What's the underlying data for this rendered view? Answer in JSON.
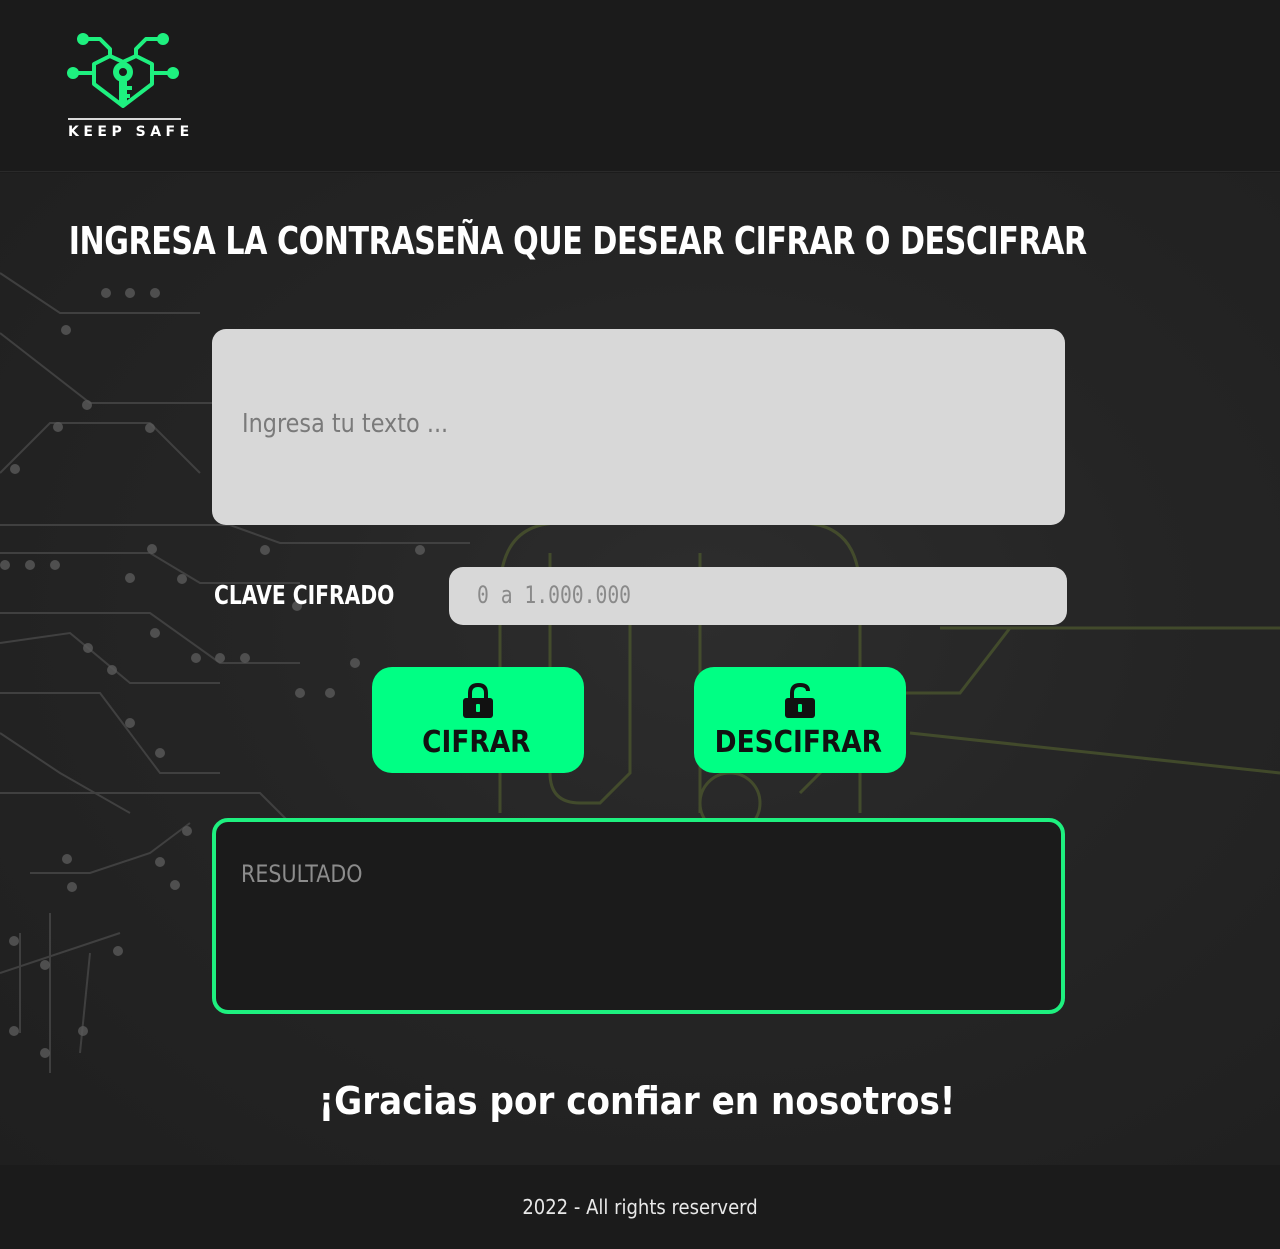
{
  "header": {
    "logo_text": "KEEP SAFE",
    "logo_icon": "circuit-key-shield-icon"
  },
  "main": {
    "title": "INGRESA LA CONTRASEÑA QUE DESEAR CIFRAR O DESCIFRAR",
    "text_input": {
      "placeholder": "Ingresa tu texto ...",
      "value": ""
    },
    "key_label": "CLAVE CIFRADO",
    "key_input": {
      "placeholder": "0 a 1.000.000",
      "value": ""
    },
    "buttons": {
      "encrypt": {
        "label": "CIFRAR",
        "icon": "lock-closed-icon"
      },
      "decrypt": {
        "label": "DESCIFRAR",
        "icon": "lock-open-icon"
      }
    },
    "result": {
      "placeholder": "RESULTADO",
      "value": ""
    },
    "thanks": "¡Gracias por confiar en nosotros!"
  },
  "footer": {
    "text": "2022 - All rights reserverd"
  },
  "colors": {
    "accent": "#00ff84",
    "result_border": "#1ef07f",
    "background": "#1c1c1c",
    "input_bg": "#d8d8d8"
  }
}
